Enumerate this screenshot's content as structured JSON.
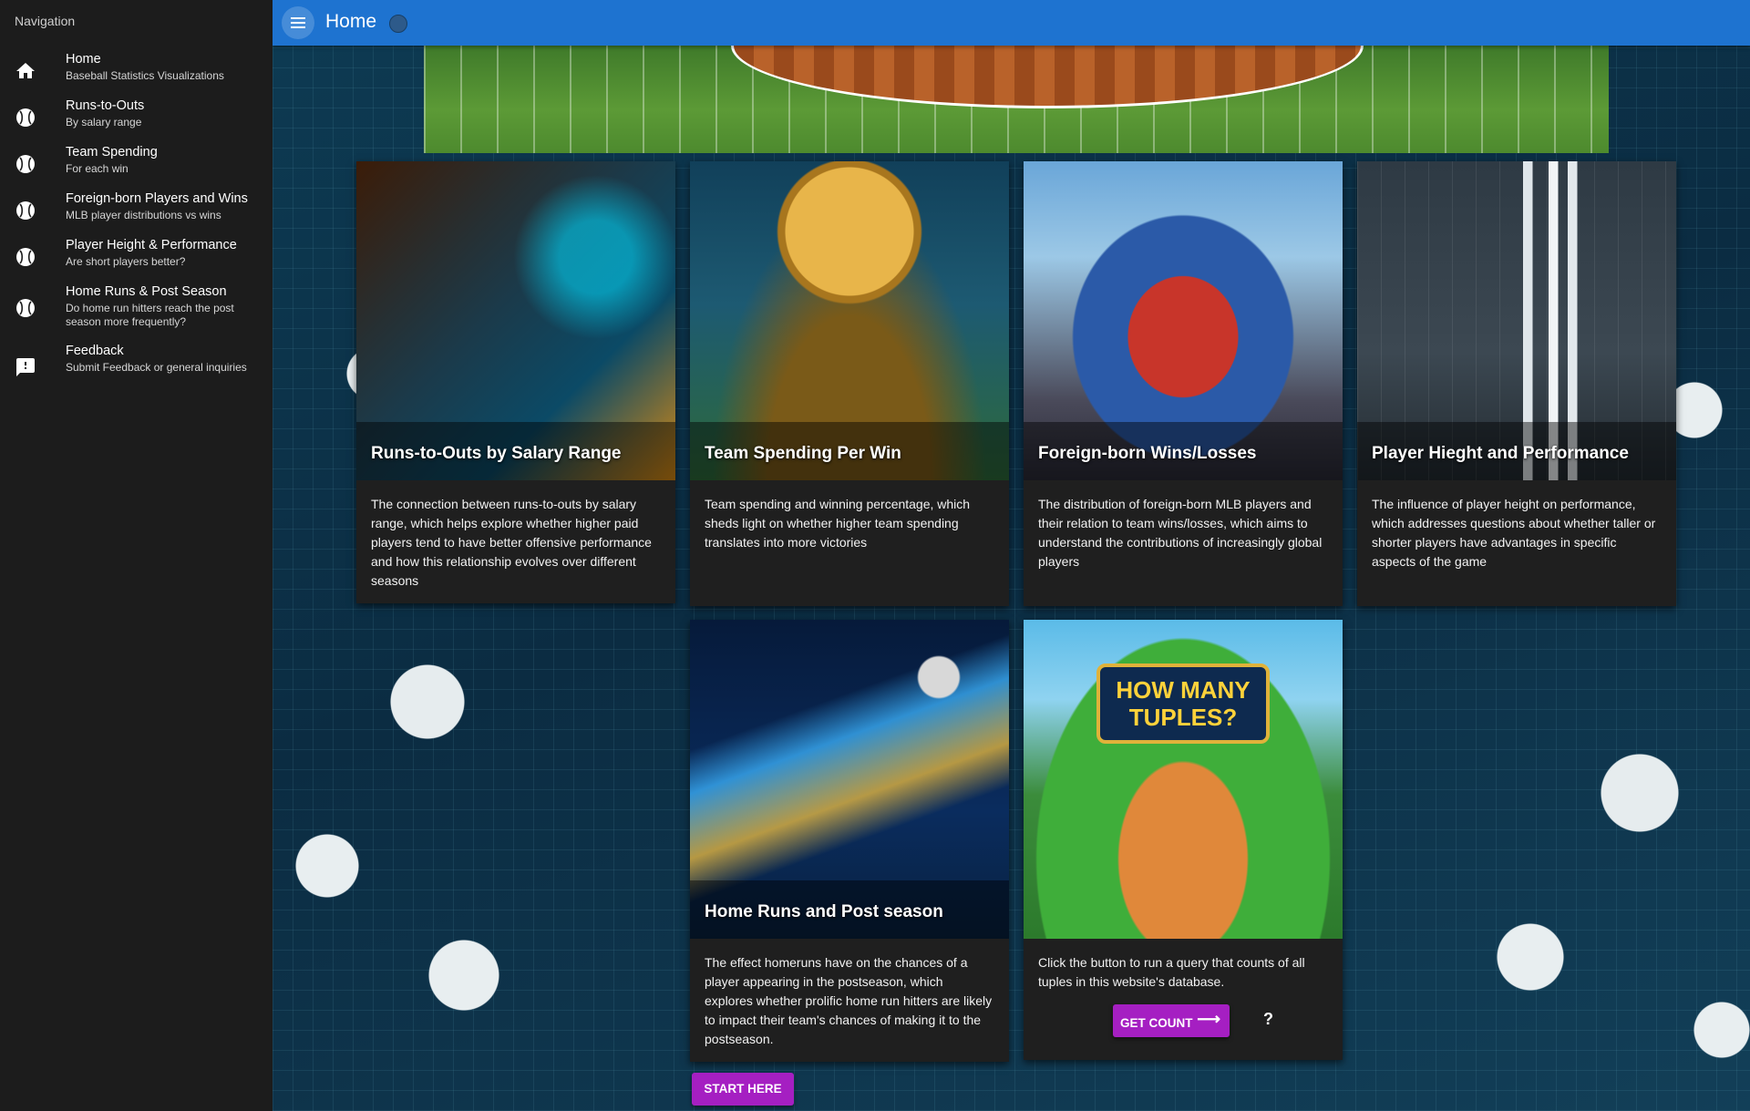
{
  "sidebar": {
    "title": "Navigation",
    "items": [
      {
        "icon": "home-icon",
        "label": "Home",
        "sub": "Baseball Statistics Visualizations"
      },
      {
        "icon": "baseball-icon",
        "label": "Runs-to-Outs",
        "sub": "By salary range"
      },
      {
        "icon": "baseball-icon",
        "label": "Team Spending",
        "sub": "For each win"
      },
      {
        "icon": "baseball-icon",
        "label": "Foreign-born Players and Wins",
        "sub": "MLB player distributions vs wins"
      },
      {
        "icon": "baseball-icon",
        "label": "Player Height & Performance",
        "sub": "Are short players better?"
      },
      {
        "icon": "baseball-icon",
        "label": "Home Runs & Post Season",
        "sub": "Do home run hitters reach the post season more frequently?"
      },
      {
        "icon": "feedback-icon",
        "label": "Feedback",
        "sub": "Submit Feedback or general inquiries"
      }
    ]
  },
  "appbar": {
    "title": "Home"
  },
  "cards": [
    {
      "title": "Runs-to-Outs by Salary Range",
      "text": "The connection between runs-to-outs by salary range, which helps explore whether higher paid players tend to have better offensive performance and how this relationship evolves over different seasons"
    },
    {
      "title": "Team Spending Per Win",
      "text": "Team spending and winning percentage, which sheds light on whether higher team spending translates into more victories"
    },
    {
      "title": "Foreign-born Wins/Losses",
      "text": "The distribution of foreign-born MLB players and their relation to team wins/losses, which aims to understand the contributions of increasingly global players"
    },
    {
      "title": "Player Hieght and Performance",
      "text": "The influence of player height on performance, which addresses questions about whether taller or shorter players have advantages in specific aspects of the game"
    },
    {
      "title": "Home Runs and Post season",
      "text": "The effect homeruns have on the chances of a player appearing in the postseason, which explores whether prolific home run hitters are likely to impact their team's chances of making it to the postseason."
    },
    {
      "title": "",
      "text": "Click the button to run a query that counts of all tuples in this website's database.",
      "art_text": "HOW MANY TUPLES?",
      "button": "GET COUNT",
      "button_icon": "arrow-right-icon",
      "result": "?"
    }
  ],
  "start_button": "START HERE",
  "colors": {
    "appbar": "#1e73d0",
    "sidebar": "#1c1c1c",
    "card": "#1f1f1f",
    "accent_button": "#a51fc2"
  }
}
